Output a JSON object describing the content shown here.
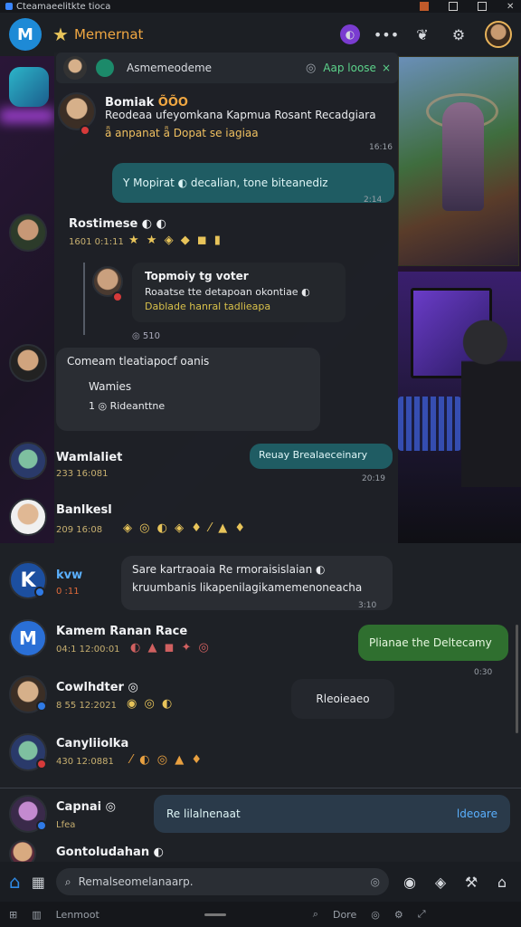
{
  "statusbar": {
    "text": "Cteamaeelitkte tioca"
  },
  "header": {
    "title": "Memernat",
    "logo": "M"
  },
  "notification": {
    "text": "Asmemeodeme",
    "tag": "Aap loose",
    "close": "×"
  },
  "messages": [
    {
      "name": "Bomiak",
      "badge": "ÕÕO",
      "text1": "Reodeaa ufeyomkana Kapmua Rosant Recadgiara",
      "text2": "ǟ anpanat ǟ Dopat se iagiaa",
      "time": "16:16"
    },
    {
      "bubble": "Y  Mopirat  ◐  decalian, tone biteanediz",
      "time": "2:14"
    },
    {
      "name": "Rostimese ◐ ◐",
      "meta": "1601 0:1:11",
      "emojis": "★ ★ ◈ ◆ ◼ ▮"
    },
    {
      "quote_name": "Topmoiy tg voter",
      "quote_1": "Roaatse tte detapoan okontiae ◐",
      "quote_2": "Dablade  hanral tadlieapa",
      "quote_meta": "◎ 510"
    },
    {
      "text": "Comeam  tleatiapocf oanis",
      "name": "Wamies",
      "line2": "1  ◎ Rideanttne"
    },
    {
      "name": "Wamlaliet",
      "meta": "233 16:081",
      "bubble": "Reuay Brealaeceinary",
      "time": "20:19"
    },
    {
      "name": "Banlkesl",
      "meta": "209 16:08",
      "emojis": "◈ ◎ ◐ ◈ ♦ ⁄ ▲ ♦"
    },
    {
      "name": "kvw",
      "meta": "0 :11",
      "bubble1": "Sare kartraoaia Re rmoraisislaian ◐",
      "bubble2": "kruumbanis likapenilagikamemenoneacha",
      "time": "3:10"
    },
    {
      "name": "Kamem Ranan Race",
      "meta": "04:1 12:00:01",
      "emojis": "◐ ▲ ◼ ✦ ◎",
      "bubble": "Plianae the Deltecamy",
      "time": "0:30"
    },
    {
      "name": "Cowlhdter ◎",
      "meta": "8 55 12:2021",
      "emojis": "◉ ◎ ◐",
      "bubble": "Rleoieaeo"
    },
    {
      "name": "Canyliiolka",
      "meta": "430 12:0881",
      "emojis": "⁄ ◐ ◎ ▲ ♦"
    },
    {
      "name": "Capnai ◎",
      "meta": "Lfea",
      "bubble": "Re lilalnenaat",
      "action": "ldeoare"
    },
    {
      "name": "Gontoludahan ◐"
    }
  ],
  "composer": {
    "placeholder": "Remalseomelanaarp."
  },
  "bottom_nav": {
    "a": "Lenmoot",
    "b": "Dore"
  }
}
